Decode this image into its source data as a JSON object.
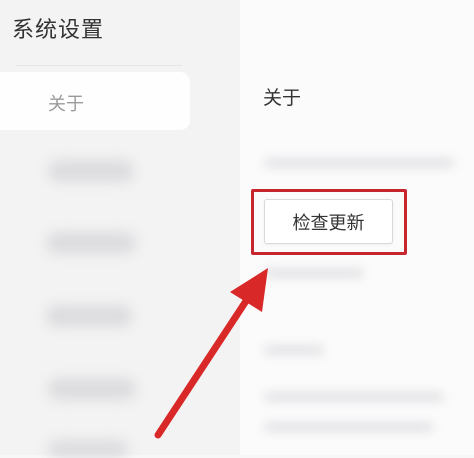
{
  "window": {
    "title": "系统设置"
  },
  "sidebar": {
    "items": [
      {
        "label": "关于",
        "active": true
      }
    ]
  },
  "main": {
    "section_title": "关于",
    "check_update_label": "检查更新"
  },
  "colors": {
    "highlight": "#c8262e",
    "arrow": "#d92828"
  }
}
